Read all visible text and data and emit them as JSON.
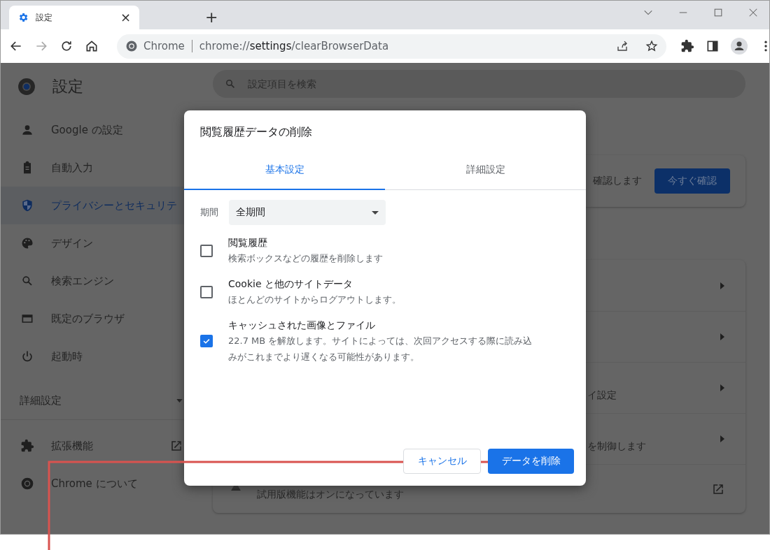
{
  "browser": {
    "tab": {
      "title": "設定",
      "close": "×"
    },
    "new_tab": "+",
    "address": {
      "site": "Chrome",
      "url": "chrome://**settings**/clearBrowserData"
    }
  },
  "settings": {
    "title": "設定",
    "search": {
      "placeholder": "設定項目を検索"
    },
    "sidebar": {
      "items": [
        {
          "label": "Google の設定",
          "selected": false
        },
        {
          "label": "自動入力",
          "selected": false
        },
        {
          "label": "プライバシーとセキュリテ",
          "selected": true
        },
        {
          "label": "デザイン",
          "selected": false
        },
        {
          "label": "検索エンジン",
          "selected": false
        },
        {
          "label": "既定のブラウザ",
          "selected": false
        },
        {
          "label": "起動時",
          "selected": false
        }
      ],
      "advanced": {
        "label": "詳細設定",
        "expanded": false
      },
      "bottom": [
        {
          "label": "拡張機能",
          "external": true
        },
        {
          "label": "Chrome について",
          "external": false
        }
      ]
    },
    "safety_card": {
      "text": "確認します",
      "button": "今すぐ確認"
    },
    "rows": [
      {
        "kind": "chevron"
      },
      {
        "kind": "chevron"
      },
      {
        "kind": "chevron",
        "text": "イ設定"
      },
      {
        "kind": "chevron",
        "text": "を制御します"
      },
      {
        "kind": "external",
        "text": "試用版機能はオンになっています"
      }
    ]
  },
  "dialog": {
    "title": "閲覧履歴データの削除",
    "tabs": [
      {
        "label": "基本設定",
        "selected": true
      },
      {
        "label": "詳細設定",
        "selected": false
      }
    ],
    "period": {
      "label": "期間",
      "value": "全期間"
    },
    "options": [
      {
        "title": "閲覧履歴",
        "description": "検索ボックスなどの履歴を削除します",
        "checked": false
      },
      {
        "title": "Cookie と他のサイトデータ",
        "description": "ほとんどのサイトからログアウトします。",
        "checked": false
      },
      {
        "title": "キャッシュされた画像とファイル",
        "description": "22.7 MB を解放します。サイトによっては、次回アクセスする際に読み込みがこれまでより遅くなる可能性があります。",
        "checked": true
      }
    ],
    "buttons": {
      "cancel": "キャンセル",
      "confirm": "データを削除"
    }
  }
}
